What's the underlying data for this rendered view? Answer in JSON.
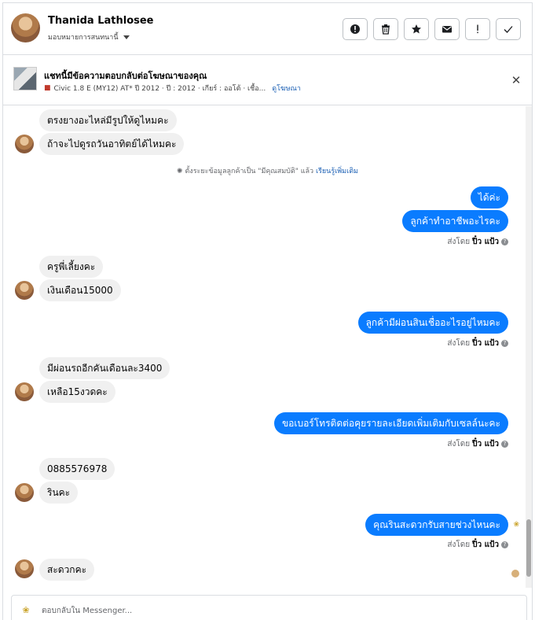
{
  "header": {
    "name": "Thanida Lathlosee",
    "assign_label": "มอบหมายการสนทนานี้"
  },
  "actions": [
    {
      "icon": "alert-icon"
    },
    {
      "icon": "trash-icon"
    },
    {
      "icon": "star-icon"
    },
    {
      "icon": "mail-icon"
    },
    {
      "icon": "exclamation-icon"
    },
    {
      "icon": "check-icon"
    }
  ],
  "banner": {
    "title": "แชทนี้มีข้อความตอบกลับต่อโฆษณาของคุณ",
    "subtitle": "Civic 1.8 E (MY12) AT* ปี 2012 · ปี : 2012 · เกียร์ : ออโต้ · เชื้อ...",
    "link": "ดูโฆษณา"
  },
  "messages": {
    "in1": "ตรงยางอะไหล่มีรูปให้ดูไหมคะ",
    "in2": "ถ้าจะไปดูรถวันอาทิตย์ได้ไหมคะ",
    "notice_text": "ตั้งระยะข้อมูลลูกค้าเป็น \"มีคุณสมบัติ\" แล้ว",
    "notice_link": "เรียนรู้เพิ่มเติม",
    "out1": "ได้ค่ะ",
    "out2": "ลูกค้าทำอาชีพอะไรคะ",
    "sentby_label": "ส่งโดย",
    "sentby_name": "ปิ๋ว แป้ว",
    "in3": "ครูพี่เลี้ยงคะ",
    "in4": "เงินเดือน15000",
    "out3": "ลูกค้ามีผ่อนสินเชื่ออะไรอยู่ไหมคะ",
    "in5": "มีผ่อนรถอีกคันเดือนละ3400",
    "in6": "เหลือ15งวดคะ",
    "out4": "ขอเบอร์โทรติดต่อคุยรายละเอียดเพิ่มเติมกับเซลล์นะคะ",
    "in7": "0885576978",
    "in8": "รินคะ",
    "out5": "คุณรินสะดวกรับสายช่วงไหนคะ",
    "in9": "สะดวกคะ"
  },
  "composer": {
    "placeholder": "ตอบกลับใน Messenger..."
  }
}
